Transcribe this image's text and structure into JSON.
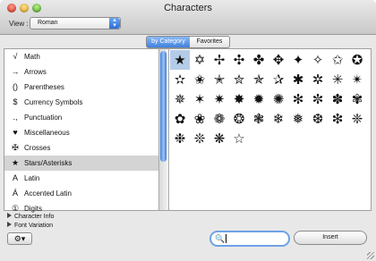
{
  "window": {
    "title": "Characters"
  },
  "toolbar": {
    "view_label": "View :",
    "view_value": "Roman"
  },
  "tabs": [
    {
      "label": "by Category",
      "selected": true
    },
    {
      "label": "Favorites",
      "selected": false
    }
  ],
  "categories": [
    {
      "icon": "√",
      "label": "Math"
    },
    {
      "icon": "→",
      "label": "Arrows"
    },
    {
      "icon": "()",
      "label": "Parentheses"
    },
    {
      "icon": "$",
      "label": "Currency Symbols"
    },
    {
      "icon": ".,",
      "label": "Punctuation"
    },
    {
      "icon": "♥",
      "label": "Miscellaneous"
    },
    {
      "icon": "✠",
      "label": "Crosses"
    },
    {
      "icon": "★",
      "label": "Stars/Asterisks"
    },
    {
      "icon": "A",
      "label": "Latin"
    },
    {
      "icon": "Á",
      "label": "Accented Latin"
    },
    {
      "icon": "①",
      "label": "Digits"
    }
  ],
  "selected_category": "Stars/Asterisks",
  "characters": [
    "★",
    "✡",
    "✢",
    "✣",
    "✤",
    "✥",
    "✦",
    "✧",
    "✩",
    "✪",
    "✫",
    "✬",
    "✭",
    "✮",
    "✯",
    "✰",
    "✱",
    "✲",
    "✳",
    "✴",
    "✵",
    "✶",
    "✷",
    "✸",
    "✹",
    "✺",
    "✻",
    "✼",
    "✽",
    "✾",
    "✿",
    "❀",
    "❁",
    "❂",
    "❃",
    "❄",
    "❅",
    "❆",
    "❇",
    "❈",
    "❉",
    "❊",
    "❋",
    "☆"
  ],
  "bottom": {
    "character_info_label": "Character Info",
    "font_variation_label": "Font Variation",
    "insert_label": "Insert",
    "search_value": ""
  },
  "colors": {
    "selection_blue": "#3f82e0",
    "selected_cell": "#b5cce8"
  }
}
